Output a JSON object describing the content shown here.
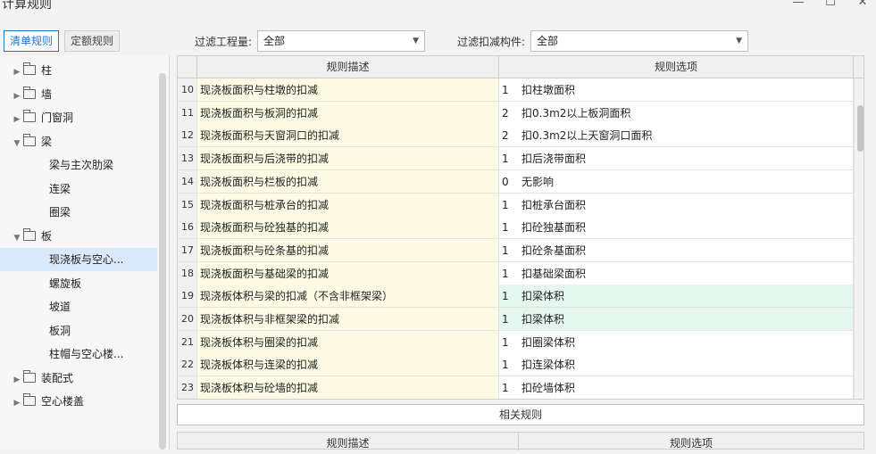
{
  "window": {
    "title": "计算规则",
    "minimize": "—",
    "maximize": "☐",
    "close": "✕"
  },
  "left_tabs": [
    {
      "label": "清单规则",
      "active": true
    },
    {
      "label": "定额规则",
      "active": false
    }
  ],
  "filters": {
    "project": {
      "label": "过滤工程量:",
      "value": "全部"
    },
    "component": {
      "label": "过滤扣减构件:",
      "value": "全部"
    }
  },
  "tree": [
    {
      "label": "柱",
      "level": 0,
      "expanded": false,
      "folder": true
    },
    {
      "label": "墙",
      "level": 0,
      "expanded": false,
      "folder": true
    },
    {
      "label": "门窗洞",
      "level": 0,
      "expanded": false,
      "folder": true
    },
    {
      "label": "梁",
      "level": 0,
      "expanded": true,
      "folder": true
    },
    {
      "label": "梁与主次肋梁",
      "level": 1
    },
    {
      "label": "连梁",
      "level": 1
    },
    {
      "label": "圈梁",
      "level": 1
    },
    {
      "label": "板",
      "level": 0,
      "expanded": true,
      "folder": true
    },
    {
      "label": "现浇板与空心...",
      "level": 1,
      "selected": true
    },
    {
      "label": "螺旋板",
      "level": 1
    },
    {
      "label": "坡道",
      "level": 1
    },
    {
      "label": "板洞",
      "level": 1
    },
    {
      "label": "柱帽与空心楼...",
      "level": 1
    },
    {
      "label": "装配式",
      "level": 0,
      "expanded": false,
      "folder": true
    },
    {
      "label": "空心楼盖",
      "level": 0,
      "expanded": false,
      "folder": true
    }
  ],
  "grid": {
    "headers": {
      "desc": "规则描述",
      "option": "规则选项"
    },
    "rows": [
      {
        "num": "10",
        "desc": "现浇板面积与柱墩的扣减",
        "code": "1",
        "option": "扣柱墩面积"
      },
      {
        "num": "11",
        "desc": "现浇板面积与板洞的扣减",
        "code": "2",
        "option": "扣0.3m2以上板洞面积"
      },
      {
        "num": "12",
        "desc": "现浇板面积与天窗洞口的扣减",
        "code": "2",
        "option": "扣0.3m2以上天窗洞口面积"
      },
      {
        "num": "13",
        "desc": "现浇板面积与后浇带的扣减",
        "code": "1",
        "option": "扣后浇带面积"
      },
      {
        "num": "14",
        "desc": "现浇板面积与栏板的扣减",
        "code": "0",
        "option": "无影响"
      },
      {
        "num": "15",
        "desc": "现浇板面积与桩承台的扣减",
        "code": "1",
        "option": "扣桩承台面积"
      },
      {
        "num": "16",
        "desc": "现浇板面积与砼独基的扣减",
        "code": "1",
        "option": "扣砼独基面积"
      },
      {
        "num": "17",
        "desc": "现浇板面积与砼条基的扣减",
        "code": "1",
        "option": "扣砼条基面积"
      },
      {
        "num": "18",
        "desc": "现浇板面积与基础梁的扣减",
        "code": "1",
        "option": "扣基础梁面积"
      },
      {
        "num": "19",
        "desc": "现浇板体积与梁的扣减（不含非框架梁）",
        "code": "1",
        "option": "扣梁体积",
        "highlight": true
      },
      {
        "num": "20",
        "desc": "现浇板体积与非框架梁的扣减",
        "code": "1",
        "option": "扣梁体积",
        "highlight": true
      },
      {
        "num": "21",
        "desc": "现浇板体积与圈梁的扣减",
        "code": "1",
        "option": "扣圈梁体积"
      },
      {
        "num": "22",
        "desc": "现浇板体积与连梁的扣减",
        "code": "1",
        "option": "扣连梁体积"
      },
      {
        "num": "23",
        "desc": "现浇板体积与砼墙的扣减",
        "code": "1",
        "option": "扣砼墙体积"
      }
    ]
  },
  "related": {
    "label": "相关规则"
  },
  "grid2": {
    "headers": {
      "desc": "规则描述",
      "option": "规则选项"
    }
  },
  "colors": {
    "accent": "#1b73d3",
    "desc_bg": "#fdfbe3",
    "highlight_bg": "#e4f6ee"
  }
}
